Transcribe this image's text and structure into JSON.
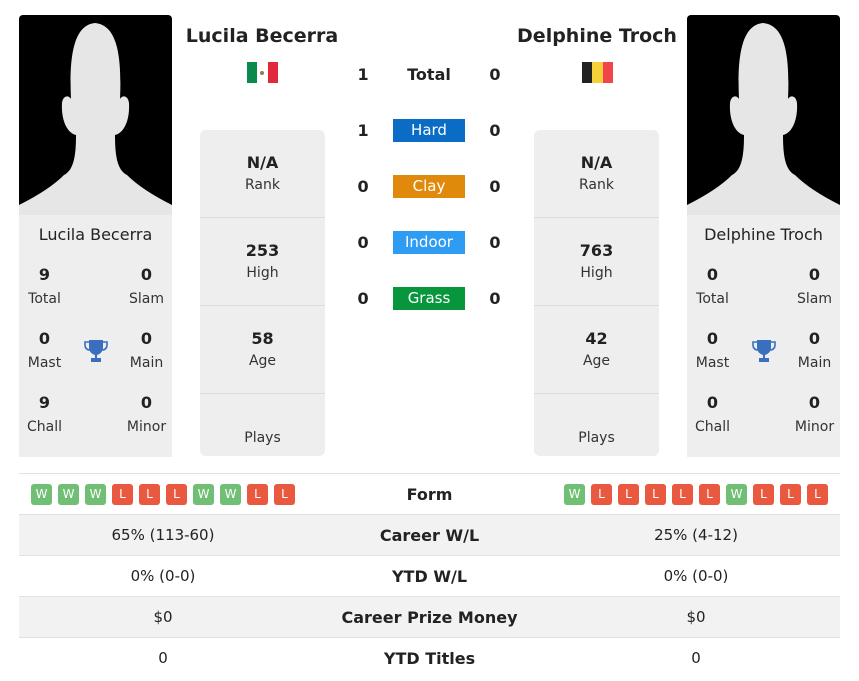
{
  "colors": {
    "hard": "#0a6cc4",
    "clay": "#e08a0b",
    "indoor": "#2e9cf2",
    "grass": "#07963c",
    "win": "#71bf74",
    "loss": "#e8593f",
    "trophy": "#3a6fbf"
  },
  "player1": {
    "name": "Lucila Becerra",
    "flag": "mexico-flag",
    "rank": "N/A",
    "rank_label": "Rank",
    "high": "253",
    "high_label": "High",
    "age": "58",
    "age_label": "Age",
    "plays_label": "Plays",
    "titles": [
      {
        "value": "9",
        "label": "Total"
      },
      {
        "value": "0",
        "label": "Slam"
      },
      {
        "value": "0",
        "label": "Mast"
      },
      {
        "value": "0",
        "label": "Main"
      },
      {
        "value": "9",
        "label": "Chall"
      },
      {
        "value": "0",
        "label": "Minor"
      }
    ],
    "form": [
      "W",
      "W",
      "W",
      "L",
      "L",
      "L",
      "W",
      "W",
      "L",
      "L"
    ]
  },
  "player2": {
    "name": "Delphine Troch",
    "flag": "belgium-flag",
    "rank": "N/A",
    "rank_label": "Rank",
    "high": "763",
    "high_label": "High",
    "age": "42",
    "age_label": "Age",
    "plays_label": "Plays",
    "titles": [
      {
        "value": "0",
        "label": "Total"
      },
      {
        "value": "0",
        "label": "Slam"
      },
      {
        "value": "0",
        "label": "Mast"
      },
      {
        "value": "0",
        "label": "Main"
      },
      {
        "value": "0",
        "label": "Chall"
      },
      {
        "value": "0",
        "label": "Minor"
      }
    ],
    "form": [
      "W",
      "L",
      "L",
      "L",
      "L",
      "L",
      "W",
      "L",
      "L",
      "L"
    ]
  },
  "h2h": {
    "total": {
      "label": "Total",
      "p1": "1",
      "p2": "0"
    },
    "surfaces": [
      {
        "label": "Hard",
        "p1": "1",
        "p2": "0",
        "key": "hard"
      },
      {
        "label": "Clay",
        "p1": "0",
        "p2": "0",
        "key": "clay"
      },
      {
        "label": "Indoor",
        "p1": "0",
        "p2": "0",
        "key": "indoor"
      },
      {
        "label": "Grass",
        "p1": "0",
        "p2": "0",
        "key": "grass"
      }
    ]
  },
  "stats": {
    "form_label": "Form",
    "rows": [
      {
        "label": "Career W/L",
        "p1": "65% (113-60)",
        "p2": "25% (4-12)"
      },
      {
        "label": "YTD W/L",
        "p1": "0% (0-0)",
        "p2": "0% (0-0)"
      },
      {
        "label": "Career Prize Money",
        "p1": "$0",
        "p2": "$0"
      },
      {
        "label": "YTD Titles",
        "p1": "0",
        "p2": "0"
      }
    ]
  }
}
